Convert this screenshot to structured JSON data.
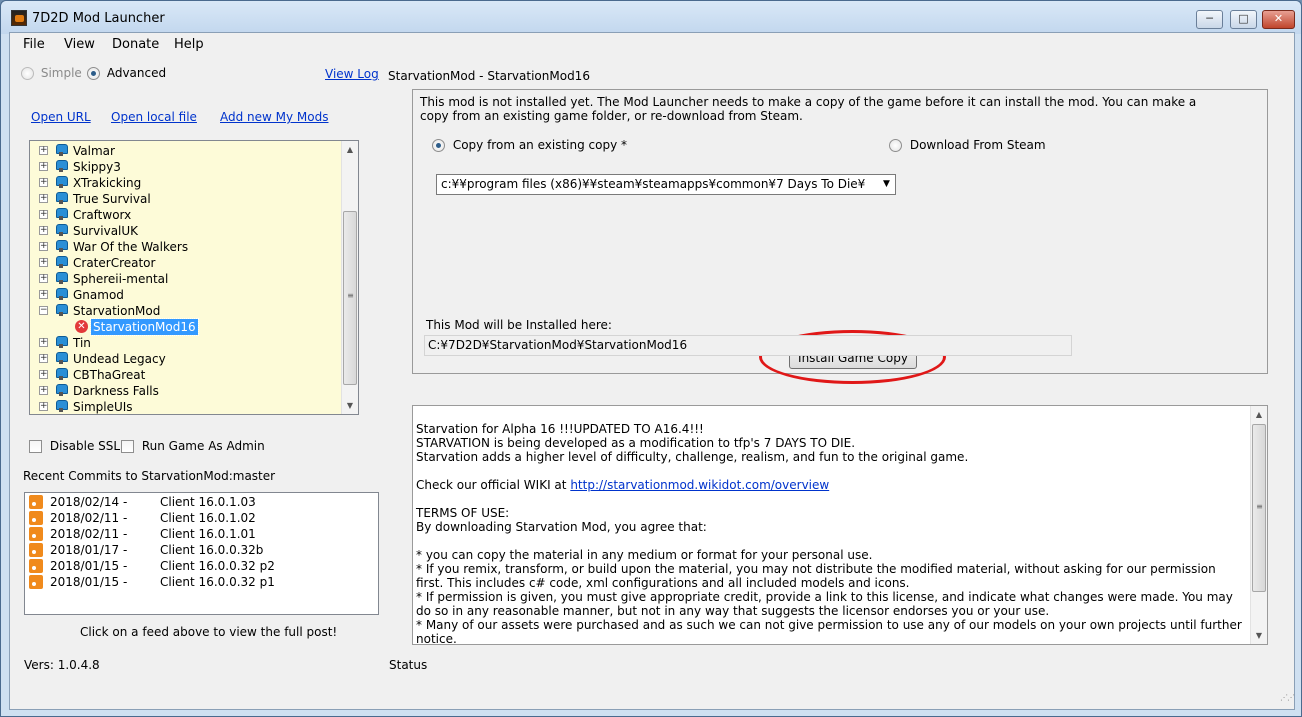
{
  "window": {
    "title": "7D2D Mod Launcher",
    "buttons": {
      "minimize": "─",
      "maximize": "□",
      "close": "✕"
    }
  },
  "menu": [
    "File",
    "View",
    "Donate",
    "Help"
  ],
  "mode": {
    "simple": "Simple",
    "advanced": "Advanced",
    "selected": "Advanced"
  },
  "view_log": "View Log",
  "links": {
    "open_url": "Open URL",
    "open_local": "Open local file",
    "add_new": "Add new My Mods"
  },
  "tree": {
    "items": [
      {
        "label": "Valmar",
        "type": "mod",
        "expanded": false
      },
      {
        "label": "Skippy3",
        "type": "mod",
        "expanded": false
      },
      {
        "label": "XTrakicking",
        "type": "mod",
        "expanded": false
      },
      {
        "label": "True Survival",
        "type": "mod",
        "expanded": false
      },
      {
        "label": "Craftworx",
        "type": "mod",
        "expanded": false
      },
      {
        "label": "SurvivalUK",
        "type": "mod",
        "expanded": false
      },
      {
        "label": "War Of the Walkers",
        "type": "mod",
        "expanded": false
      },
      {
        "label": "CraterCreator",
        "type": "mod",
        "expanded": false
      },
      {
        "label": "Sphereii-mental",
        "type": "mod",
        "expanded": false
      },
      {
        "label": "Gnamod",
        "type": "mod",
        "expanded": false
      },
      {
        "label": "StarvationMod",
        "type": "mod",
        "expanded": true
      },
      {
        "label": "StarvationMod16",
        "type": "child",
        "selected": true
      },
      {
        "label": "Tin",
        "type": "mod",
        "expanded": false
      },
      {
        "label": "Undead Legacy",
        "type": "mod",
        "expanded": false
      },
      {
        "label": "CBThaGreat",
        "type": "mod",
        "expanded": false
      },
      {
        "label": "Darkness Falls",
        "type": "mod",
        "expanded": false
      },
      {
        "label": "SimpleUIs",
        "type": "mod",
        "expanded": false
      }
    ]
  },
  "options": {
    "disable_ssl": "Disable SSL",
    "run_as_admin": "Run Game As Admin"
  },
  "commits": {
    "header": "Recent Commits to StarvationMod:master",
    "rows": [
      {
        "date": "2018/02/14 -",
        "text": "Client 16.0.1.03"
      },
      {
        "date": "2018/02/11 -",
        "text": "Client 16.0.1.02"
      },
      {
        "date": "2018/02/11 -",
        "text": "Client 16.0.1.01"
      },
      {
        "date": "2018/01/17 -",
        "text": "Client 16.0.0.32b"
      },
      {
        "date": "2018/01/15 -",
        "text": "Client 16.0.0.32 p2"
      },
      {
        "date": "2018/01/15 -",
        "text": "Client 16.0.0.32 p1"
      }
    ],
    "footer": "Click on a feed above to view the full post!"
  },
  "version": "Vers: 1.0.4.8",
  "status": "Status",
  "mod_header": "StarvationMod - StarvationMod16",
  "install": {
    "notice": "This mod is not installed yet. The Mod Launcher needs to make a copy of the game before it can install the mod. You can make a copy from an existing game folder, or re-download from Steam.",
    "copy_existing": "Copy from an existing copy *",
    "download_steam": "Download From Steam",
    "selected_source": "Copy from an existing copy *",
    "game_path": "c:¥¥program files (x86)¥¥steam¥steamapps¥common¥7 Days To Die¥",
    "button": "Install Game Copy",
    "target_label": "This Mod will be Installed here:",
    "target_path": "C:¥7D2D¥StarvationMod¥StarvationMod16"
  },
  "description": {
    "before_link": "Starvation for Alpha 16 !!!UPDATED TO A16.4!!!\nSTARVATION is being developed as a modification to tfp's 7 DAYS TO DIE.\nStarvation adds a higher level of difficulty, challenge, realism, and fun to the original game.\n\nCheck our official WIKI at ",
    "link": "http://starvationmod.wikidot.com/overview",
    "after_link": "\n\nTERMS OF USE:\nBy downloading Starvation Mod, you agree that:\n\n* you can copy the material in any medium or format for your personal use.\n* If you remix, transform, or build upon the material, you may not distribute the modified material, without asking for our permission first. This includes c# code, xml configurations and all included models and icons.\n* If permission is given, you must give appropriate credit, provide a link to this license, and indicate what changes were made. You may do so in any reasonable manner, but not in any way that suggests the licensor endorses you or your use.\n* Many of our assets were purchased and as such we can not give permission to use any of our models on your own projects until further notice."
  },
  "colors": {
    "tree_bg": "#fdfbd8",
    "selection": "#3399ff",
    "link": "#0033cc",
    "highlight": "#e01818"
  }
}
